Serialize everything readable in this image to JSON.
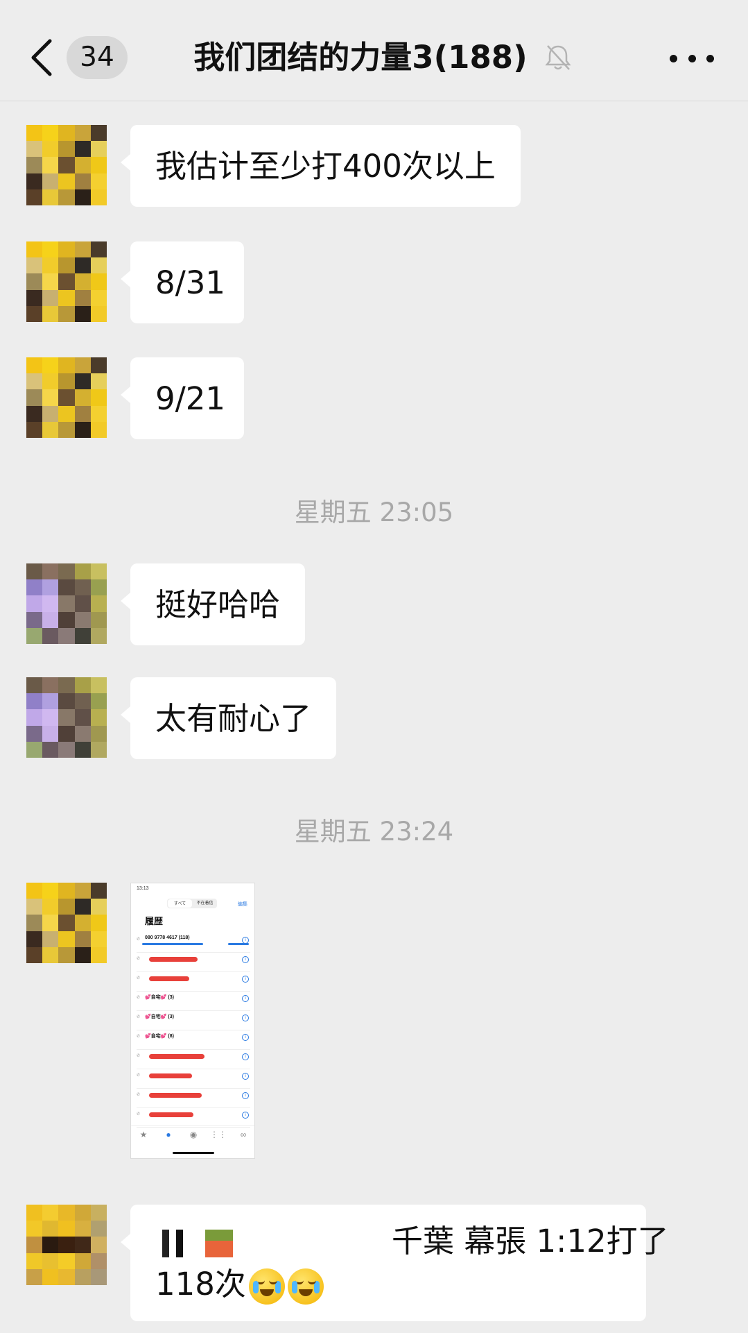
{
  "header": {
    "unread_count": "34",
    "title": "我们团结的力量3(188)",
    "mute_icon": "bell-slash-icon",
    "more_icon": "ellipsis-icon"
  },
  "messages": [
    {
      "type": "text",
      "text": "我估计至少打400次以上"
    },
    {
      "type": "text",
      "text": "8/31"
    },
    {
      "type": "text",
      "text": "9/21"
    },
    {
      "type": "time",
      "text": "星期五 23:05"
    },
    {
      "type": "text",
      "text": "挺好哈哈"
    },
    {
      "type": "text",
      "text": "太有耐心了"
    },
    {
      "type": "time",
      "text": "星期五 23:24"
    },
    {
      "type": "image",
      "screenshot": {
        "status_time": "13:13",
        "seg_all": "すべて",
        "seg_missed": "不在着信",
        "edit": "編集",
        "title": "履歴",
        "first_row": "080 9778 4617 (118)",
        "rows": [
          "💕自宅💕 (3)",
          "💕自宅💕 (3)",
          "💕自宅💕 (8)"
        ],
        "tab_icons": [
          "★",
          "●",
          "◉",
          "⋮⋮",
          "∞"
        ]
      }
    },
    {
      "type": "text",
      "text_part1": "千葉 幕張 1:12打了",
      "text_part2": "118次",
      "emoji": "loudly-crying-face-icon"
    }
  ],
  "colors": {
    "background": "#ededed",
    "bubble": "#ffffff",
    "timestamp": "#a8a8a8"
  }
}
